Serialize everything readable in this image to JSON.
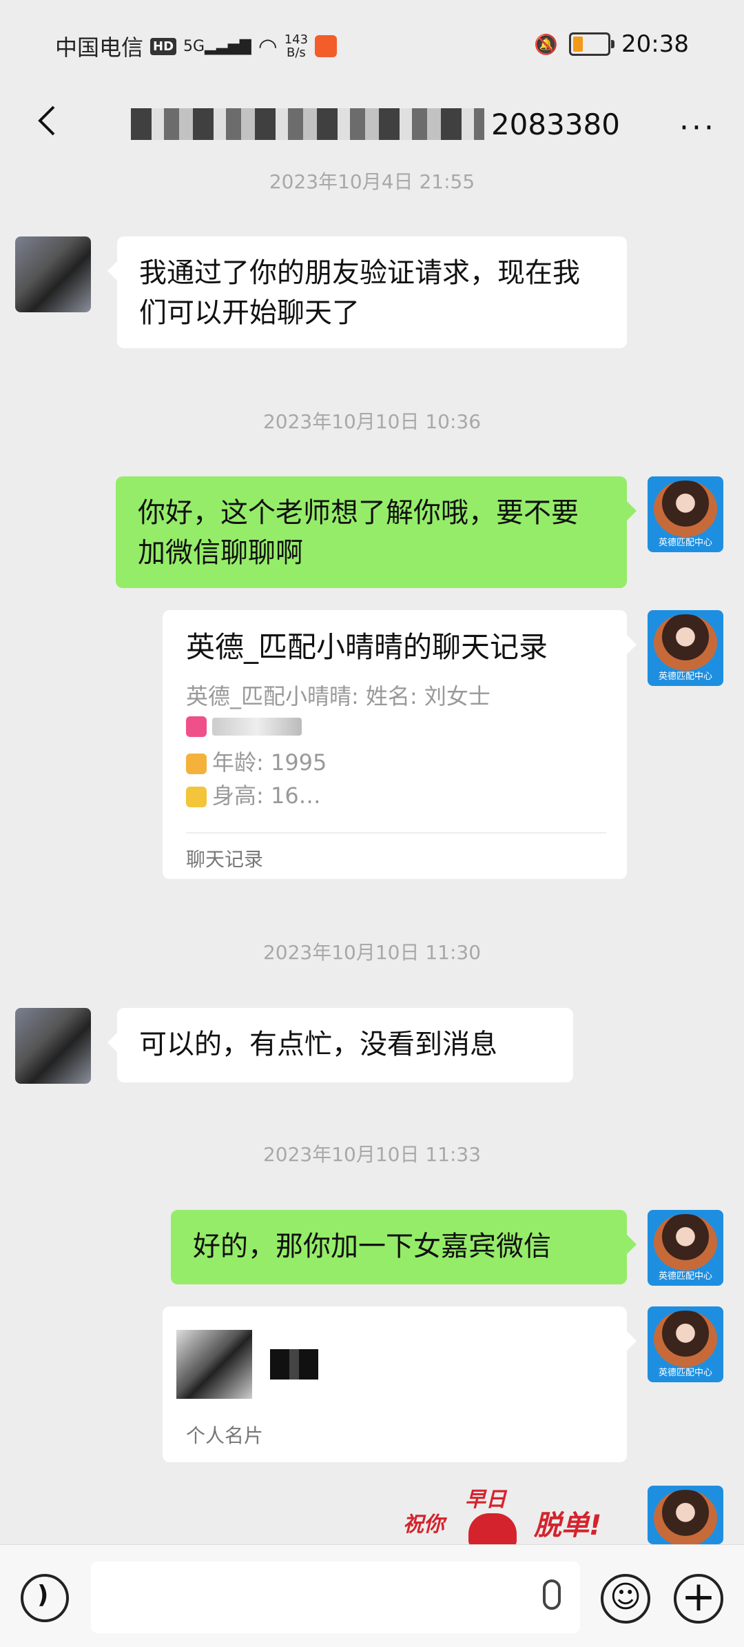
{
  "status_bar": {
    "carrier": "中国电信",
    "hd": "HD",
    "network": "5G",
    "speed_value": "143",
    "speed_unit": "B/s",
    "time": "20:38",
    "battery_percent": 20
  },
  "nav": {
    "title_suffix": "2083380",
    "more": "···"
  },
  "messages": {
    "ts1": "2023年10月4日 21:55",
    "m1": "我通过了你的朋友验证请求，现在我们可以开始聊天了",
    "ts2": "2023年10月10日 10:36",
    "m2": "你好，这个老师想了解你哦，要不要加微信聊聊啊",
    "card": {
      "title": "英德_匹配小晴晴的聊天记录",
      "line1": "英德_匹配小晴晴: 姓名: 刘女士",
      "line2": "",
      "line3": "年龄: 1995",
      "line4": "身高: 16…",
      "footer": "聊天记录"
    },
    "ts3": "2023年10月10日 11:30",
    "m3": "可以的，有点忙，没看到消息",
    "ts4": "2023年10月10日 11:33",
    "m4": "好的，那你加一下女嘉宾微信",
    "contact_card": {
      "footer": "个人名片"
    }
  },
  "sticker": {
    "text_top": "早日",
    "text_left": "祝你",
    "text_right": "脱单!"
  },
  "avatar_caption": "英德匹配中心",
  "colors": {
    "self_bubble": "#95ec69",
    "other_bubble": "#ffffff",
    "background": "#ededed"
  }
}
